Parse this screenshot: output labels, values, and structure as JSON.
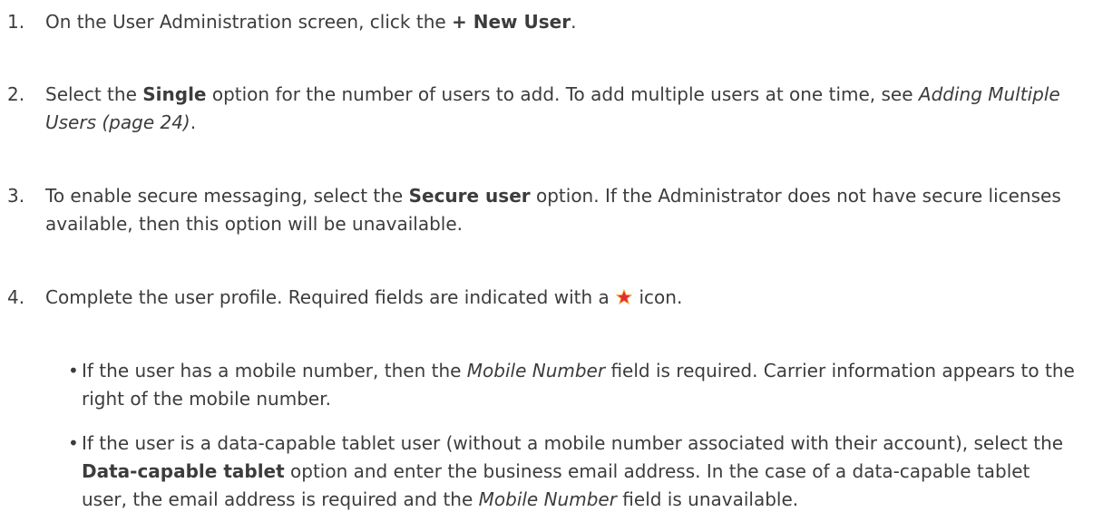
{
  "steps": [
    {
      "number": "1.",
      "text_a": "On the User Administration screen, click the ",
      "bold_a": "+ New User",
      "text_b": "."
    },
    {
      "number": "2.",
      "text_a": "Select the ",
      "bold_a": "Single",
      "text_b": " option for the number of users to add. To add multiple users at one time, see ",
      "italic_a": "Adding Multiple Users (page 24)",
      "text_c": "."
    },
    {
      "number": "3.",
      "text_a": "To enable secure messaging, select the ",
      "bold_a": "Secure user",
      "text_b": " option. If the Administrator does not have secure licenses available, then this option will be unavailable."
    },
    {
      "number": "4.",
      "text_a": "Complete the user profile. Required fields are indicated with a ",
      "icon": "required-star-icon",
      "icon_color": "#e8283c",
      "text_b": " icon."
    }
  ],
  "bullets": [
    {
      "marker": "•",
      "text_a": "If the user has a mobile number, then the ",
      "italic_a": "Mobile Number",
      "text_b": " field is required. Carrier information appears to the right of the mobile number."
    },
    {
      "marker": "•",
      "text_a": "If the user is a data-capable tablet user (without a mobile number associated with their account), select the ",
      "bold_a": "Data-capable tablet",
      "text_b": " option and enter the business email address. In the case of a data-capable tablet user, the email address is required and the ",
      "italic_a": "Mobile Number",
      "text_c": " field is unavailable."
    }
  ]
}
